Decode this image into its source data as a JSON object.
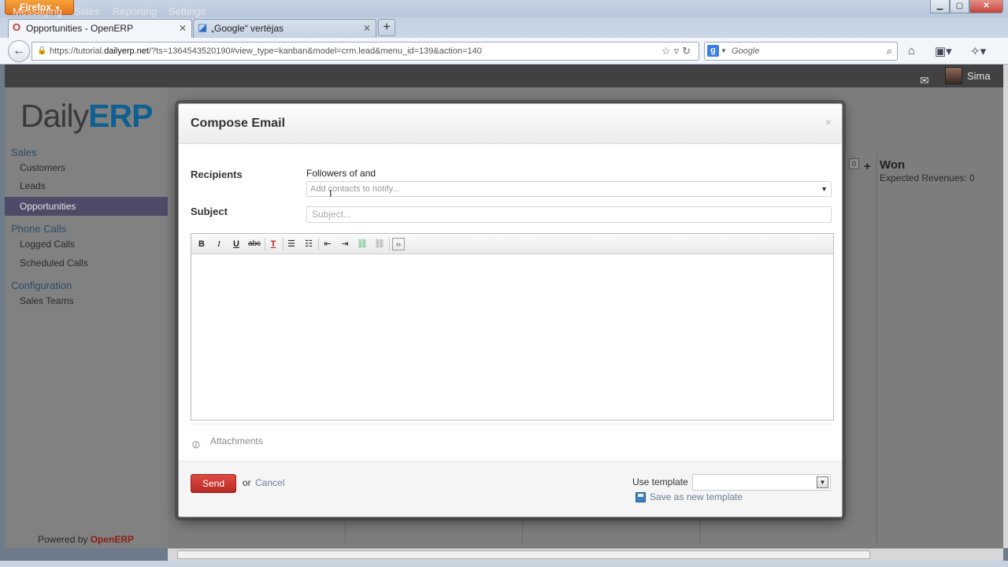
{
  "browser": {
    "firefox_button": "Firefox",
    "tabs": [
      {
        "title": "Opportunities - OpenERP"
      },
      {
        "title": "„Google“ vertėjas"
      }
    ],
    "url_prefix": "https://tutorial.",
    "url_domain": "dailyerp.net",
    "url_rest": "/?ts=1364543520190#view_type=kanban&model=crm.lead&menu_id=139&action=140",
    "search_placeholder": "Google"
  },
  "app": {
    "top_menu": [
      "Messaging",
      "Sales",
      "Reporting",
      "Settings"
    ],
    "user_name": "Sima",
    "logo_left": "Daily",
    "logo_right": "ERP",
    "sidebar": {
      "sections": [
        {
          "label": "Sales",
          "items": [
            "Customers",
            "Leads",
            "Opportunities"
          ]
        },
        {
          "label": "Phone Calls",
          "items": [
            "Logged Calls",
            "Scheduled Calls"
          ]
        },
        {
          "label": "Configuration",
          "items": [
            "Sales Teams"
          ]
        }
      ],
      "active_item": "Opportunities"
    },
    "powered_by": "Powered by",
    "powered_brand": "OpenERP",
    "kanban": {
      "won_title": "Won",
      "won_count": "0",
      "won_revenue": "Expected Revenues: 0"
    }
  },
  "modal": {
    "title": "Compose Email",
    "close": "×",
    "recipients_label": "Recipients",
    "followers_text": "Followers of  and",
    "contacts_placeholder": "Add contacts to notify...",
    "subject_label": "Subject",
    "subject_placeholder": "Subject...",
    "toolbar": [
      "B",
      "I",
      "U",
      "abc"
    ],
    "attachments_label": "Attachments",
    "send_label": "Send",
    "or_text": "or",
    "cancel_label": "Cancel",
    "use_template_label": "Use template",
    "template_value": "",
    "save_template_label": "Save as new template"
  },
  "colors": {
    "accent": "#0e5f92",
    "send_button": "#c9302c",
    "active_menu": "#4f4a68"
  }
}
